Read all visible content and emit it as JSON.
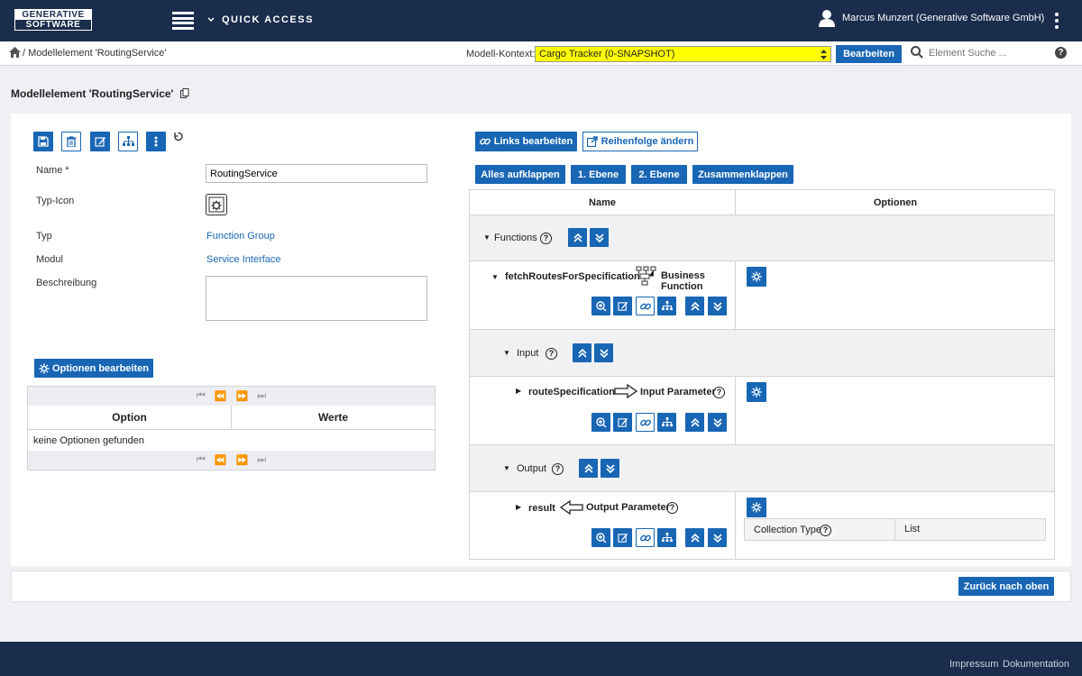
{
  "header": {
    "logo_line1": "GENERATIVE",
    "logo_line2": "SOFTWARE",
    "quick_access": "QUICK ACCESS",
    "user_name": "Marcus Munzert (Generative Software GmbH)"
  },
  "subbar": {
    "breadcrumb": "/ Modellelement 'RoutingService'",
    "context_label": "Modell-Kontext:",
    "context_value": "Cargo Tracker (0-SNAPSHOT)",
    "edit_label": "Bearbeiten",
    "search_placeholder": "Element Suche ..."
  },
  "page": {
    "title": "Modellelement 'RoutingService'"
  },
  "form": {
    "name_label": "Name",
    "required_mark": "*",
    "name_value": "RoutingService",
    "type_icon_label": "Typ-Icon",
    "type_label": "Typ",
    "type_value": "Function Group",
    "module_label": "Modul",
    "module_value": "Service Interface",
    "description_label": "Beschreibung",
    "description_value": ""
  },
  "options": {
    "edit_button": "Optionen bearbeiten",
    "col_option": "Option",
    "col_values": "Werte",
    "empty_text": "keine Optionen gefunden"
  },
  "tree": {
    "links_button": "Links bearbeiten",
    "order_button": "Reihenfolge ändern",
    "expand_all": "Alles aufklappen",
    "level1": "1. Ebene",
    "level2": "2. Ebene",
    "collapse": "Zusammenklappen",
    "col_name": "Name",
    "col_options": "Optionen",
    "functions": "Functions",
    "fetch_routes": "fetchRoutesForSpecification",
    "business_function": "Business Function",
    "input": "Input",
    "route_spec": "routeSpecification",
    "input_parameter": "Input Parameter",
    "output": "Output",
    "result": "result",
    "output_parameter": "Output Parameter",
    "collection_type_label": "Collection Type",
    "collection_type_value": "List"
  },
  "bottom": {
    "back_to_top": "Zurück nach oben"
  },
  "footer": {
    "impressum": "Impressum",
    "documentation": "Dokumentation"
  },
  "colors": {
    "primary": "#1866b4",
    "header_bg": "#1a2d4c",
    "context_highlight": "#ffff00"
  }
}
